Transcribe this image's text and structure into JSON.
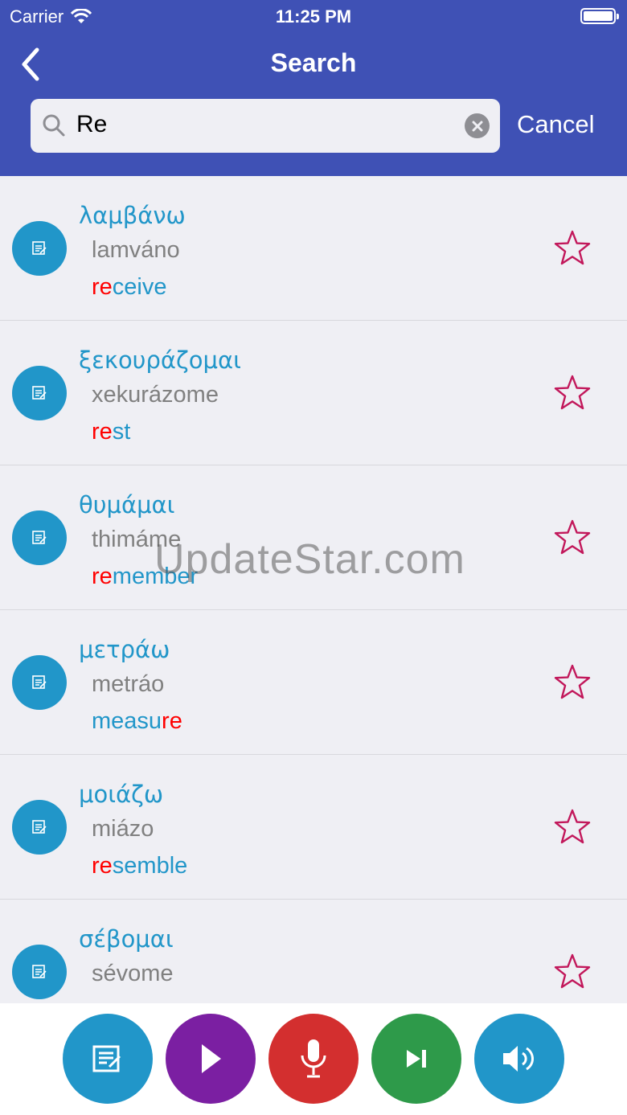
{
  "status_bar": {
    "carrier": "Carrier",
    "time": "11:25 PM"
  },
  "header": {
    "title": "Search",
    "cancel_label": "Cancel"
  },
  "search": {
    "value": "Re"
  },
  "items": [
    {
      "greek": "λαμβάνω",
      "translit": "lamváno",
      "english_pre": "",
      "english_hl": "re",
      "english_post": "ceive"
    },
    {
      "greek": "ξεκουράζομαι",
      "translit": "xekurázome",
      "english_pre": "",
      "english_hl": "re",
      "english_post": "st"
    },
    {
      "greek": "θυμάμαι",
      "translit": "thimáme",
      "english_pre": "",
      "english_hl": "re",
      "english_post": "member"
    },
    {
      "greek": "μετράω",
      "translit": "metráo",
      "english_pre": "measu",
      "english_hl": "re",
      "english_post": ""
    },
    {
      "greek": "μοιάζω",
      "translit": "miázo",
      "english_pre": "",
      "english_hl": "re",
      "english_post": "semble"
    },
    {
      "greek": "σέβομαι",
      "translit": "sévome",
      "english_pre": "",
      "english_hl": "",
      "english_post": ""
    }
  ],
  "watermark": "UpdateStar.com",
  "colors": {
    "header": "#3f51b5",
    "accent": "#2196c9",
    "highlight": "#ff0000",
    "star": "#c2185b",
    "btn_notes": "#2196c9",
    "btn_play": "#7b1fa2",
    "btn_mic": "#d32f2f",
    "btn_next": "#2e9a4a",
    "btn_sound": "#2196c9"
  },
  "icons": [
    "back-chevron-icon",
    "search-icon",
    "clear-icon",
    "note-icon",
    "star-icon",
    "edit-icon",
    "play-icon",
    "microphone-icon",
    "skip-next-icon",
    "speaker-icon"
  ]
}
